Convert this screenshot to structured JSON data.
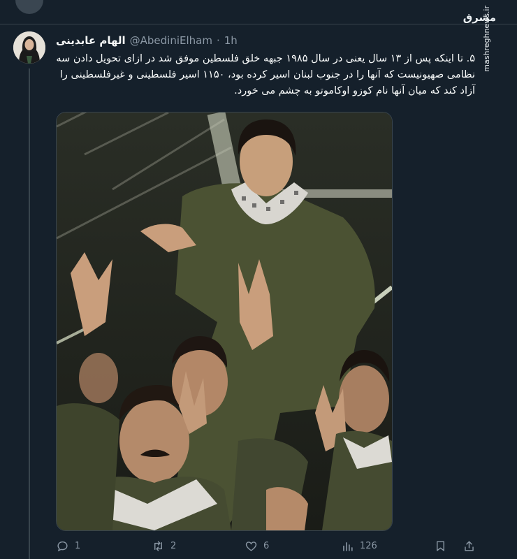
{
  "tweet": {
    "display_name": "الهام عابدینی",
    "handle": "@AbediniElham",
    "separator": "·",
    "time": "1h",
    "text": "۵. تا اینکه پس از ۱۳ سال یعنی در سال ۱۹۸۵ جبهه خلق فلسطین موفق شد در ازای تحویل دادن سه نظامی صهیونیست که آنها را در جنوب لبنان اسیر کرده بود، ۱۱۵۰ اسیر فلسطینی و غیرفلسطینی را آزاد کند که میان آنها نام کوزو اوکاموتو به چشم می خورد."
  },
  "actions": {
    "reply": {
      "icon": "reply-icon",
      "count": "1"
    },
    "retweet": {
      "icon": "retweet-icon",
      "count": "2"
    },
    "like": {
      "icon": "heart-icon",
      "count": "6"
    },
    "views": {
      "icon": "views-icon",
      "count": "126"
    },
    "bookmark": {
      "icon": "bookmark-icon"
    },
    "share": {
      "icon": "share-icon"
    }
  },
  "watermark": {
    "logo": "مشرق",
    "url": "mashreghnews.ir"
  },
  "colors": {
    "background": "#15202b",
    "border": "#38444d",
    "secondary_text": "#8b98a5",
    "primary_text": "#f7f9f9"
  }
}
